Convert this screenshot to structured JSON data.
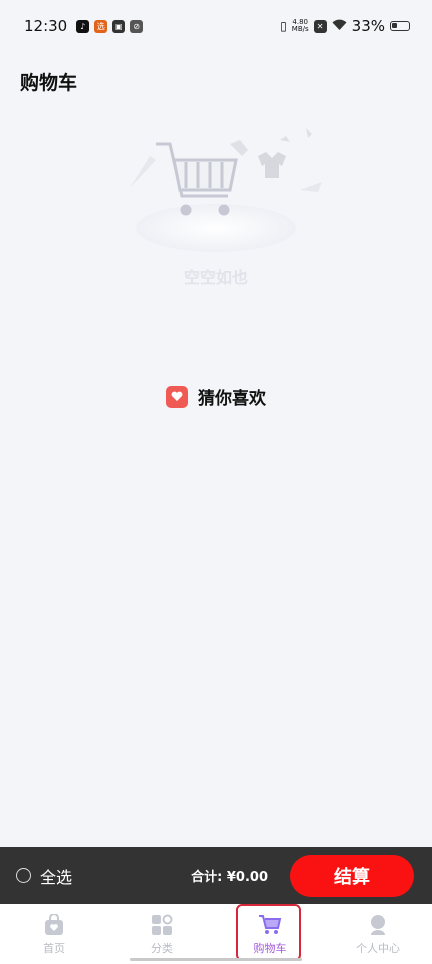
{
  "status_bar": {
    "time": "12:30",
    "net_speed": "4.80",
    "net_unit": "MB/s",
    "battery": "33%"
  },
  "header": {
    "title": "购物车"
  },
  "empty_state": {
    "text": "空空如也"
  },
  "guess": {
    "title": "猜你喜欢"
  },
  "checkout": {
    "select_all": "全选",
    "total_label": "合计:",
    "total_value": "¥0.00",
    "pay_button": "结算"
  },
  "tabbar": {
    "items": [
      {
        "label": "首页",
        "icon": "home-bag-icon"
      },
      {
        "label": "分类",
        "icon": "category-icon"
      },
      {
        "label": "购物车",
        "icon": "cart-icon",
        "active": true
      },
      {
        "label": "个人中心",
        "icon": "user-icon"
      }
    ]
  },
  "colors": {
    "accent": "#fa1212",
    "active_tab": "#a35bdc",
    "heart": "#ef5a55",
    "checkout_bar": "#333333"
  }
}
